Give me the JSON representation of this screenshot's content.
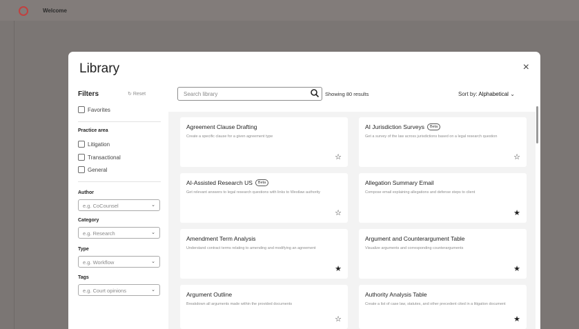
{
  "app": {
    "title": "Welcome"
  },
  "modal": {
    "title": "Library",
    "close_icon": "×"
  },
  "filters": {
    "title": "Filters",
    "reset_label": "Reset",
    "favorites_label": "Favorites",
    "practice_area_label": "Practice area",
    "practice_areas": [
      "Litigation",
      "Transactional",
      "General"
    ],
    "author": {
      "label": "Author",
      "placeholder": "e.g. CoCounsel"
    },
    "category": {
      "label": "Category",
      "placeholder": "e.g. Research"
    },
    "type": {
      "label": "Type",
      "placeholder": "e.g. Workflow"
    },
    "tags": {
      "label": "Tags",
      "placeholder": "e.g. Court opinions"
    }
  },
  "search": {
    "placeholder": "Search library"
  },
  "results": {
    "showing_text": "Showing 80 results"
  },
  "sort": {
    "prefix": "Sort by:",
    "value": "Alphabetical"
  },
  "cards": [
    {
      "title": "Agreement Clause Drafting",
      "badge": "",
      "description": "Create a specific clause for a given agreement type",
      "favorited": false
    },
    {
      "title": "AI Jurisdiction Surveys",
      "badge": "Beta",
      "description": "Get a survey of the law across jurisdictions based on a legal research question",
      "favorited": false
    },
    {
      "title": "AI-Assisted Research US",
      "badge": "Beta",
      "description": "Get relevant answers to legal research questions with links to Westlaw authority",
      "favorited": false
    },
    {
      "title": "Allegation Summary Email",
      "badge": "",
      "description": "Compose email explaining allegations and defense steps to client",
      "favorited": true
    },
    {
      "title": "Amendment Term Analysis",
      "badge": "",
      "description": "Understand contract terms relating to amending and modifying an agreement",
      "favorited": true
    },
    {
      "title": "Argument and Counterargument Table",
      "badge": "",
      "description": "Visualize arguments and corresponding counterarguments",
      "favorited": true
    },
    {
      "title": "Argument Outline",
      "badge": "",
      "description": "Breakdown all arguments made within the provided documents",
      "favorited": false
    },
    {
      "title": "Authority Analysis Table",
      "badge": "",
      "description": "Create a list of case law, statutes, and other precedent cited in a litigation document",
      "favorited": true
    }
  ],
  "colors": {
    "overlay": "#7b7674",
    "logo": "#c2403f",
    "panel_bg": "#f3f3f3"
  },
  "icons": {
    "star_empty": "☆",
    "star_filled": "★",
    "chevron": "⌄",
    "reset_icon": "↻"
  }
}
